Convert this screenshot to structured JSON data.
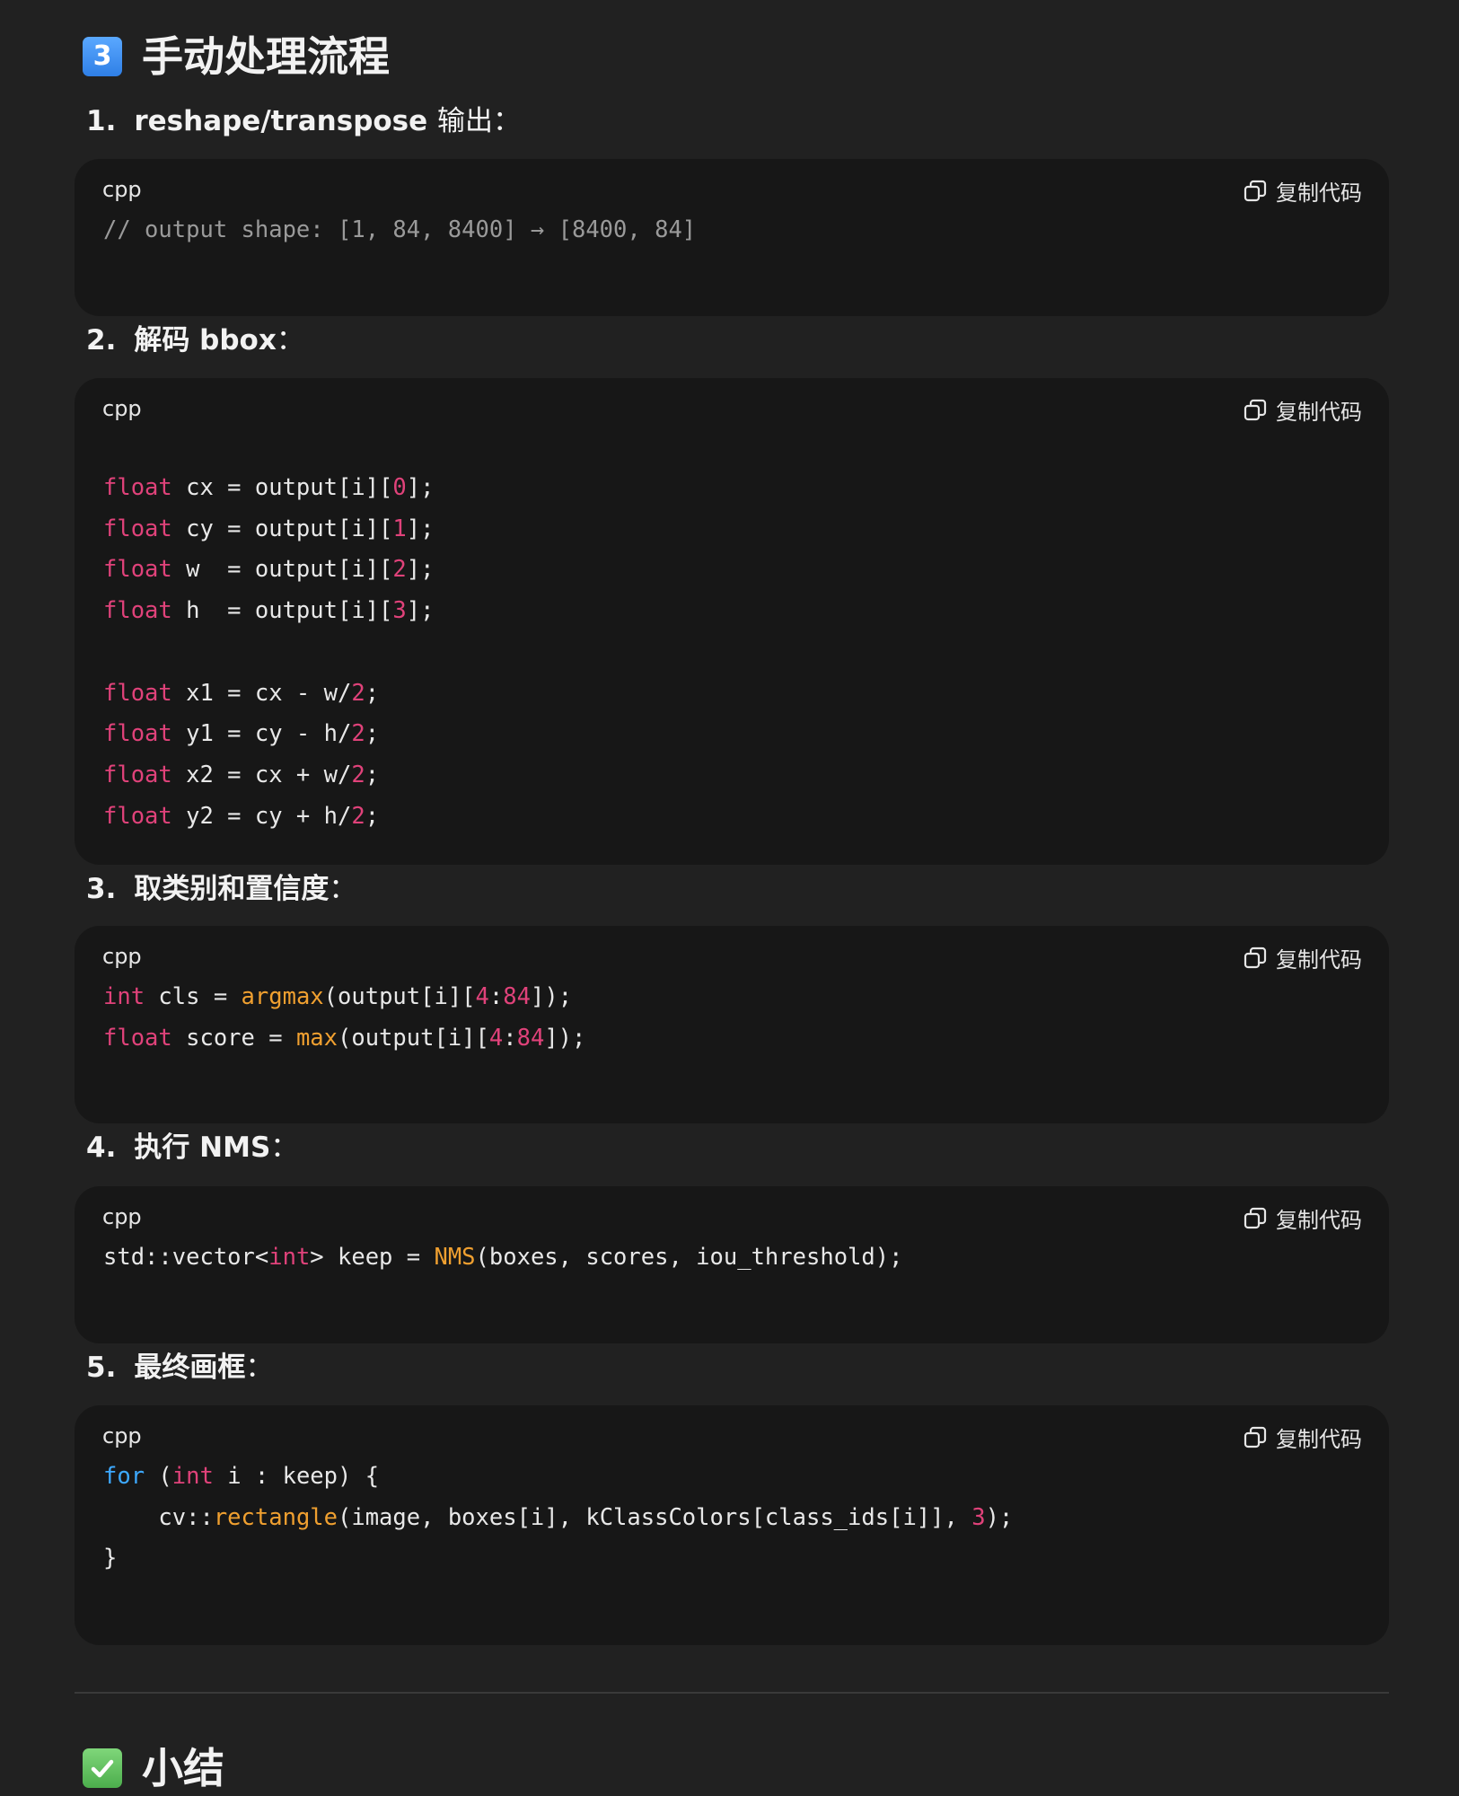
{
  "section_main": {
    "emoji": "3",
    "title": "手动处理流程"
  },
  "steps": [
    {
      "num": "1.",
      "title": "reshape/transpose",
      "suffix": "输出："
    },
    {
      "num": "2.",
      "title": "解码 bbox",
      "suffix": "："
    },
    {
      "num": "3.",
      "title": "取类别和置信度",
      "suffix": "："
    },
    {
      "num": "4.",
      "title": "执行 NMS",
      "suffix": "："
    },
    {
      "num": "5.",
      "title": "最终画框",
      "suffix": "："
    }
  ],
  "code_blocks": [
    {
      "lang": "cpp",
      "copy_label": "复制代码",
      "lines": [
        "// output shape: [1, 84, 8400] → [8400, 84]"
      ]
    },
    {
      "lang": "cpp",
      "copy_label": "复制代码",
      "lines": [
        "float cx = output[i][0];",
        "float cy = output[i][1];",
        "float w  = output[i][2];",
        "float h  = output[i][3];",
        "",
        "float x1 = cx - w/2;",
        "float y1 = cy - h/2;",
        "float x2 = cx + w/2;",
        "float y2 = cy + h/2;"
      ]
    },
    {
      "lang": "cpp",
      "copy_label": "复制代码",
      "lines": [
        "int cls = argmax(output[i][4:84]);",
        "float score = max(output[i][4:84]);"
      ]
    },
    {
      "lang": "cpp",
      "copy_label": "复制代码",
      "lines": [
        "std::vector<int> keep = NMS(boxes, scores, iou_threshold);"
      ]
    },
    {
      "lang": "cpp",
      "copy_label": "复制代码",
      "lines": [
        "for (int i : keep) {",
        "    cv::rectangle(image, boxes[i], kClassColors[class_ids[i]], 3);",
        "}"
      ]
    }
  ],
  "section_summary": {
    "emoji": "check-mark",
    "title": "小结"
  },
  "colors": {
    "background": "#212121",
    "card": "#171717",
    "keyword": "#e0427a",
    "keyword_blue": "#3da9ff",
    "function": "#f0a030",
    "comment": "#9a9a9a"
  }
}
